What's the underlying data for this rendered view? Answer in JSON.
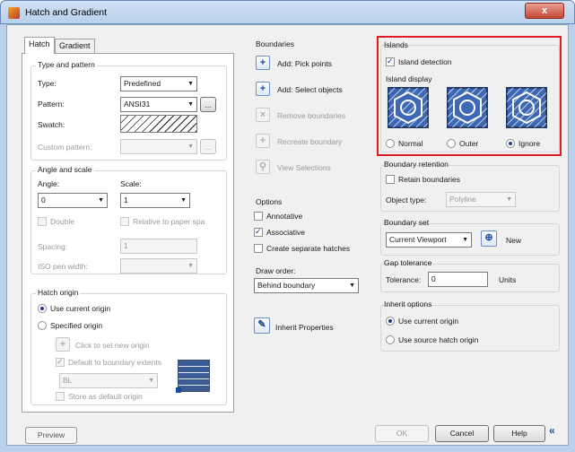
{
  "window": {
    "title": "Hatch and Gradient",
    "close_glyph": "x"
  },
  "tabs": {
    "hatch": "Hatch",
    "gradient": "Gradient"
  },
  "type_pattern": {
    "header": "Type and pattern",
    "type_label": "Type:",
    "type_value": "Predefined",
    "pattern_label": "Pattern:",
    "pattern_value": "ANSI31",
    "browse_label": "...",
    "swatch_label": "Swatch:",
    "custom_pattern_label": "Custom pattern:",
    "custom_browse_label": "..."
  },
  "angle_scale": {
    "header": "Angle and scale",
    "angle_label": "Angle:",
    "angle_value": "0",
    "scale_label": "Scale:",
    "scale_value": "1",
    "double_label": "Double",
    "relative_label": "Relative to paper spa",
    "spacing_label": "Spacing:",
    "spacing_value": "1",
    "iso_pen_label": "ISO pen width:"
  },
  "hatch_origin": {
    "header": "Hatch origin",
    "use_current": "Use current origin",
    "specified": "Specified origin",
    "click_to_set": "Click to set new origin",
    "default_extents": "Default to boundary extents",
    "position_value": "BL",
    "store_default": "Store as default origin"
  },
  "boundaries": {
    "header": "Boundaries",
    "add_pick": "Add: Pick points",
    "add_select": "Add: Select objects",
    "remove": "Remove boundaries",
    "recreate": "Recreate boundary",
    "view": "View Selections"
  },
  "options": {
    "header": "Options",
    "annotative": "Annotative",
    "associative": "Associative",
    "separate": "Create separate hatches",
    "draw_order_label": "Draw order:",
    "draw_order_value": "Behind boundary"
  },
  "inherit_properties": "Inherit Properties",
  "islands": {
    "header": "Islands",
    "detection": "Island detection",
    "display_label": "Island display",
    "normal": "Normal",
    "outer": "Outer",
    "ignore": "Ignore"
  },
  "retention": {
    "header": "Boundary retention",
    "retain": "Retain boundaries",
    "object_type_label": "Object type:",
    "object_type_value": "Polyline"
  },
  "boundary_set": {
    "header": "Boundary set",
    "value": "Current Viewport",
    "new_label": "New"
  },
  "gap": {
    "header": "Gap tolerance",
    "label": "Tolerance:",
    "value": "0",
    "units": "Units"
  },
  "inherit_options": {
    "header": "Inherit options",
    "use_current": "Use current origin",
    "use_source": "Use source hatch origin"
  },
  "footer": {
    "preview": "Preview",
    "ok": "OK",
    "cancel": "Cancel",
    "help": "Help",
    "collapse": "«"
  },
  "colors": {
    "accent": "#1c4b9a",
    "highlight": "#e01b24",
    "titlebar": "#b9d1ec"
  }
}
